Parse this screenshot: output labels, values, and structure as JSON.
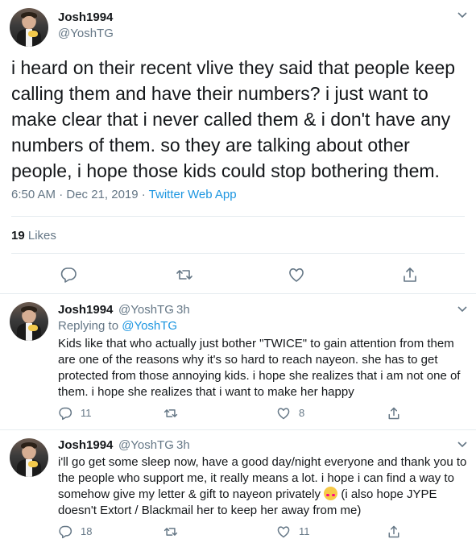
{
  "main_tweet": {
    "name": "Josh1994",
    "handle": "@YoshTG",
    "text": "i heard on their recent vlive they said that people keep calling them and have their numbers? i just want to make clear that i never called them & i don't have any numbers of them. so they are talking about other people, i hope those kids could stop bothering them.",
    "time": "6:50 AM · Dec 21, 2019 · ",
    "app": "Twitter Web App",
    "likes_count": "19",
    "likes_label": " Likes"
  },
  "reply1": {
    "name": "Josh1994",
    "handle": "@YoshTG",
    "dot": "·",
    "time": "3h",
    "replying_label": "Replying to ",
    "replying_handle": "@YoshTG",
    "text": "Kids like that who actually just bother \"TWICE\" to gain attention from them are one of the reasons why it's so hard to reach nayeon. she has to get protected from those annoying kids. i hope she realizes that i am not one of them. i hope she realizes that i want to make her happy",
    "reply_count": "11",
    "retweet_count": "",
    "like_count": "8"
  },
  "reply2": {
    "name": "Josh1994",
    "handle": "@YoshTG",
    "dot": "·",
    "time": "3h",
    "text_before_emoji": "i'll go get some sleep now, have a good day/night everyone and thank you to the people who support me, it really means a lot. i hope i can find a way to somehow give my letter & gift to nayeon privately ",
    "text_after_emoji": " (i also hope JYPE doesn't Extort / Blackmail her to keep her away from me)",
    "reply_count": "18",
    "retweet_count": "",
    "like_count": "11"
  },
  "icons": [
    "reply-icon",
    "retweet-icon",
    "like-icon",
    "share-icon",
    "chevron-down-icon",
    "smiling-face-with-hearts-emoji"
  ],
  "colors": {
    "link": "#1b95e0",
    "secondary": "#657786",
    "text": "#14171a",
    "divider": "#e6ecf0"
  }
}
